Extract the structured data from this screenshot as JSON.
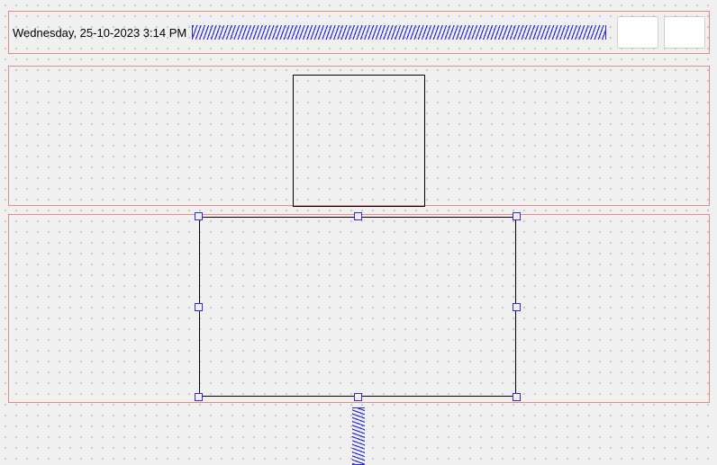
{
  "header": {
    "datetime": "Wednesday, 25-10-2023 3:14 PM"
  },
  "panels": {
    "top_rect": {
      "selected": false
    },
    "bottom_rect": {
      "selected": true
    }
  }
}
